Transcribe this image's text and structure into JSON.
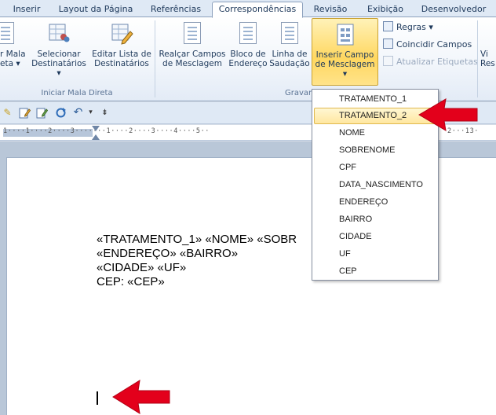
{
  "tabs": [
    "Inserir",
    "Layout da Página",
    "Referências",
    "Correspondências",
    "Revisão",
    "Exibição",
    "Desenvolvedor"
  ],
  "ribbon": {
    "iniciar_label": "Iniciar Mala Direta",
    "gravar_label": "Gravar e In",
    "btn_mala": "r Mala\neta ▾",
    "btn_selecionar": "Selecionar\nDestinatários ▾",
    "btn_editar": "Editar Lista de\nDestinatários",
    "btn_realcar": "Realçar Campos\nde Mesclagem",
    "btn_bloco": "Bloco de\nEndereço",
    "btn_linha": "Linha de\nSaudação",
    "btn_inserir": "Inserir Campo\nde Mesclagem ▾",
    "btn_vis": "Vi\nRes",
    "regras": "Regras ▾",
    "coincidir": "Coincidir Campos",
    "atualizar": "Atualizar Etiquetas"
  },
  "qat": {
    "undo": "↶",
    "caret": "▾",
    "extra": "⇟"
  },
  "ruler": {
    "left_ticks": "1····1····2····3·······1····2····3····4····5··",
    "right_ticks": "2···13·"
  },
  "document": {
    "line1": "«TRATAMENTO_1»  «NOME» «SOBR",
    "line2": "«ENDEREÇO» «BAIRRO»",
    "line3": "«CIDADE» «UF»",
    "line4": "CEP: «CEP»"
  },
  "dropdown": {
    "items": [
      "TRATAMENTO_1",
      "TRATAMENTO_2",
      "NOME",
      "SOBRENOME",
      "CPF",
      "DATA_NASCIMENTO",
      "ENDEREÇO",
      "BAIRRO",
      "CIDADE",
      "UF",
      "CEP"
    ],
    "highlighted": "TRATAMENTO_2"
  },
  "colors": {
    "accent": "#e3001b",
    "highlight": "#ffe7a0",
    "ribbon_text": "#1e395b"
  }
}
